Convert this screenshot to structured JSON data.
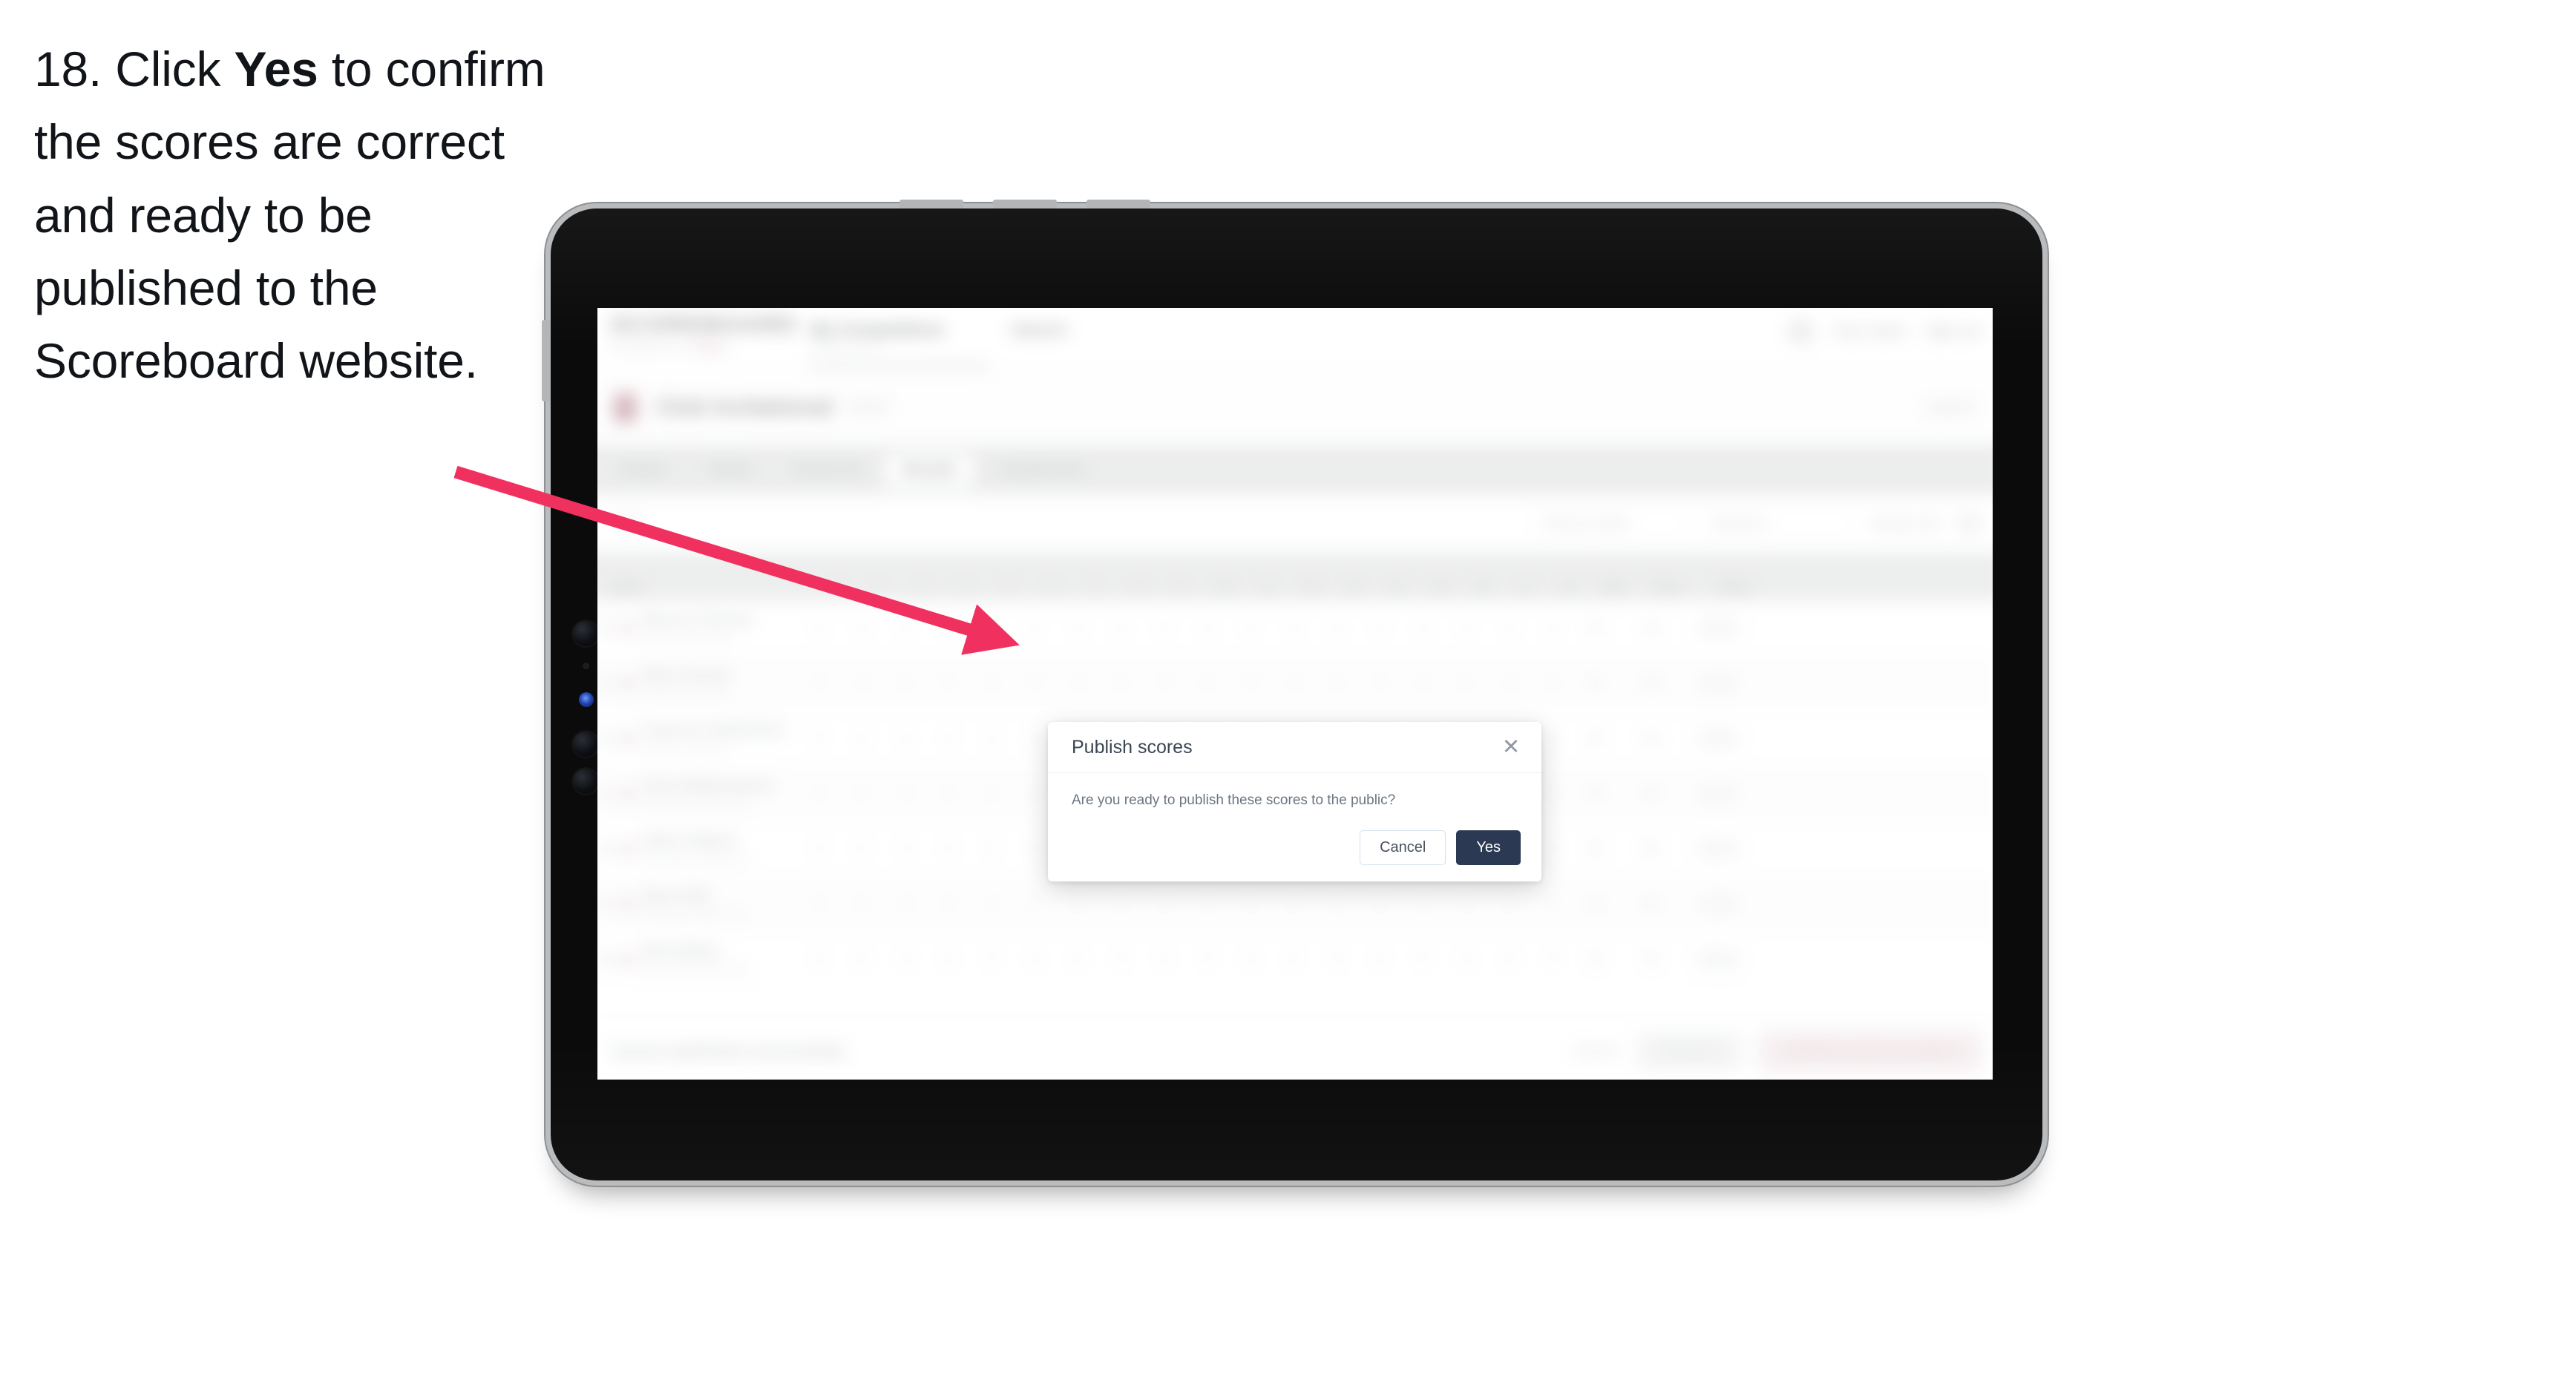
{
  "instruction": {
    "number": "18.",
    "text_before": "Click",
    "emphasis": "Yes",
    "text_after": "to confirm the scores are correct and ready to be published to the Scoreboard website."
  },
  "colors": {
    "arrow": "#F0305F",
    "accent_pink": "#EF5A82",
    "primary_dark": "#2B3A52",
    "danger_pink": "#F3A8B9"
  },
  "app": {
    "brand": {
      "name": "SCOREBOARD",
      "tagline_prefix": "POWERED BY",
      "tagline_accent": "SWIM"
    },
    "topnav": [
      {
        "label": "My Competitions",
        "sub": "Manage events"
      },
      {
        "label": "Search",
        "sub": ""
      }
    ],
    "topright": {
      "avatar": "avatar",
      "user_name": "Your name",
      "sign_out": "Sign out"
    },
    "page": {
      "title": "Club Invitational",
      "chip": "2024",
      "right_label": "Level 3"
    },
    "tabs": [
      {
        "label": "Details",
        "active": false
      },
      {
        "label": "Teams",
        "active": false
      },
      {
        "label": "Events list",
        "active": false
      },
      {
        "label": "Results",
        "active": true
      },
      {
        "label": "Leaderboard",
        "active": false
      }
    ],
    "filters": {
      "label": "Filter",
      "select_event": "Pick an event",
      "select_round": "Round 1",
      "toggle_label": "Ready only",
      "toggle_on": false
    },
    "table": {
      "columns": [
        {
          "label": "Player",
          "kind": "player"
        },
        {
          "label": "1",
          "kind": "num"
        },
        {
          "label": "2",
          "kind": "num"
        },
        {
          "label": "3",
          "kind": "num"
        },
        {
          "label": "4",
          "kind": "num"
        },
        {
          "label": "5",
          "kind": "num"
        },
        {
          "label": "6",
          "kind": "num"
        },
        {
          "label": "7",
          "kind": "num"
        },
        {
          "label": "8",
          "kind": "num"
        },
        {
          "label": "9",
          "kind": "num"
        },
        {
          "label": "10",
          "kind": "num"
        },
        {
          "label": "11",
          "kind": "num"
        },
        {
          "label": "12",
          "kind": "num"
        },
        {
          "label": "13",
          "kind": "num"
        },
        {
          "label": "14",
          "kind": "num"
        },
        {
          "label": "15",
          "kind": "num"
        },
        {
          "label": "16",
          "kind": "num"
        },
        {
          "label": "17",
          "kind": "num"
        },
        {
          "label": "18",
          "kind": "num"
        },
        {
          "label": "Total",
          "kind": "num"
        },
        {
          "label": "Place",
          "kind": "wide"
        },
        {
          "label": "Status",
          "kind": "wide"
        }
      ],
      "rows": [
        {
          "name": "Marcus Tennant",
          "club": "Coast Swim Club",
          "scores": [
            "3",
            "4",
            "3",
            "4",
            "3",
            "4",
            "3",
            "4",
            "3",
            "4",
            "3",
            "4",
            "3",
            "4",
            "3",
            "4",
            "3",
            "4"
          ],
          "total": "64",
          "place": "1st",
          "status": "Ready"
        },
        {
          "name": "Rhys Parnell",
          "club": "Coast Swim Club",
          "scores": [
            "3",
            "4",
            "3",
            "4",
            "3",
            "4",
            "3",
            "4",
            "3",
            "4",
            "3",
            "4",
            "3",
            "4",
            "3",
            "4",
            "3",
            "4"
          ],
          "total": "62",
          "place": "2nd",
          "status": "Ready"
        },
        {
          "name": "Cameron Rutherford",
          "club": "Harbour Aquatics",
          "scores": [
            "3",
            "4",
            "3",
            "4",
            "3",
            "4",
            "3",
            "4",
            "3",
            "4",
            "3",
            "4",
            "3",
            "4",
            "3",
            "4",
            "3",
            "4"
          ],
          "total": "60",
          "place": "3rd",
          "status": "Ready"
        },
        {
          "name": "Chris Wetherspoon",
          "club": "North Bay Swimmers",
          "scores": [
            "3",
            "4",
            "3",
            "4",
            "3",
            "4",
            "3",
            "4",
            "3",
            "4",
            "3",
            "4",
            "3",
            "4",
            "3",
            "4",
            "3",
            "4"
          ],
          "total": "58",
          "place": "4th",
          "status": "Ready"
        },
        {
          "name": "Oliver Halpert",
          "club": "North Bay Swimmers",
          "scores": [
            "3",
            "4",
            "3",
            "4",
            "3",
            "4",
            "3",
            "4",
            "3",
            "4",
            "3",
            "4",
            "3",
            "4",
            "3",
            "4",
            "3",
            "4"
          ],
          "total": "56",
          "place": "5th",
          "status": "Ready"
        },
        {
          "name": "Ryan Hills",
          "club": "Riverside Swim Club",
          "scores": [
            "3",
            "4",
            "3",
            "4",
            "3",
            "4",
            "3",
            "4",
            "3",
            "4",
            "3",
            "4",
            "3",
            "4",
            "3",
            "4",
            "3",
            "4"
          ],
          "total": "54",
          "place": "6th",
          "status": "Ready"
        },
        {
          "name": "Nick Bailey",
          "club": "Riverside Swim Club",
          "scores": [
            "3",
            "4",
            "3",
            "4",
            "3",
            "4",
            "3",
            "4",
            "3",
            "4",
            "3",
            "4",
            "3",
            "4",
            "3",
            "4",
            "3",
            "4"
          ],
          "total": "52",
          "place": "7th",
          "status": "Ready"
        }
      ]
    },
    "footer": {
      "note": "Scores published successfully",
      "link": "Cancel",
      "secondary_button": "Save all",
      "primary_button": "Publish scores to public"
    }
  },
  "modal": {
    "title": "Publish scores",
    "close_icon": "close-icon",
    "body": "Are you ready to publish these scores to the public?",
    "cancel_label": "Cancel",
    "confirm_label": "Yes"
  }
}
